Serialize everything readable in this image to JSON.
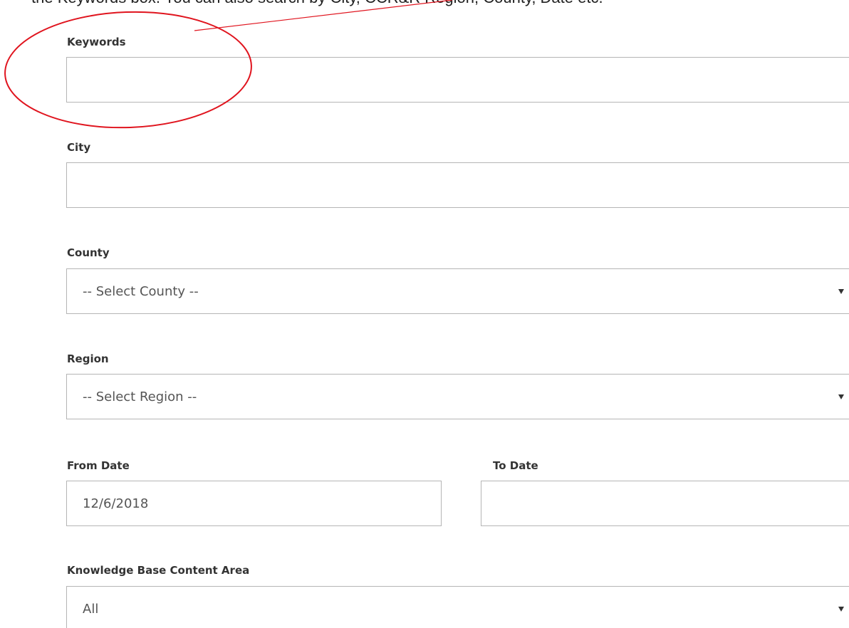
{
  "instruction": {
    "text": "the Keywords box. You can also search by City, CCR&R Region, County, Date etc."
  },
  "form": {
    "keywords": {
      "label": "Keywords",
      "value": ""
    },
    "city": {
      "label": "City",
      "value": ""
    },
    "county": {
      "label": "County",
      "selected": "-- Select County --"
    },
    "region": {
      "label": "Region",
      "selected": "-- Select Region --"
    },
    "from_date": {
      "label": "From Date",
      "value": "12/6/2018"
    },
    "to_date": {
      "label": "To Date",
      "value": ""
    },
    "content_area": {
      "label": "Knowledge Base Content Area",
      "selected": "All"
    }
  },
  "annotation": {
    "color": "#e0141e"
  }
}
